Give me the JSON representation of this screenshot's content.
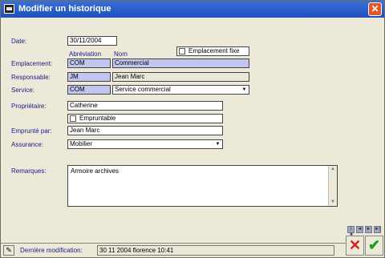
{
  "window": {
    "title": "Modifier un historique",
    "close_glyph": "✕"
  },
  "form": {
    "date": {
      "label": "Date:",
      "value": "30/11/2004"
    },
    "headers": {
      "abbreviation": "Abréviation",
      "name": "Nom"
    },
    "emplacement_fixe": {
      "label": "Emplacement fixe",
      "checked": false
    },
    "emplacement": {
      "label": "Emplacement:",
      "abbr": "COM",
      "name": "Commercial"
    },
    "responsable": {
      "label": "Responsable:",
      "abbr": "JM",
      "name": "Jean Marc"
    },
    "service": {
      "label": "Service:",
      "abbr": "COM",
      "name": "Service commercial"
    },
    "proprietaire": {
      "label": "Propriétaire:",
      "value": "Catherine"
    },
    "empruntable": {
      "label": "Empruntable",
      "checked": false
    },
    "emprunte_par": {
      "label": "Emprunté par:",
      "value": "Jean Marc"
    },
    "assurance": {
      "label": "Assurance:",
      "value": "Mobilier"
    },
    "remarques": {
      "label": "Remarques:",
      "value": "Armoire archives"
    }
  },
  "status": {
    "label": "Dernière modification:",
    "value": "30 11 2004 florence 10:41",
    "pen_glyph": "✎"
  },
  "nav": {
    "first": "|◄",
    "prev": "◄",
    "next": "►",
    "last": "►|"
  },
  "actions": {
    "cancel_glyph": "✕",
    "ok_glyph": "✔"
  },
  "colors": {
    "titlebar": "#1e4fba",
    "field_blue": "#c2c6ef",
    "label_text": "#1a1a8c",
    "cancel": "#d02020",
    "ok": "#1aa01a"
  }
}
